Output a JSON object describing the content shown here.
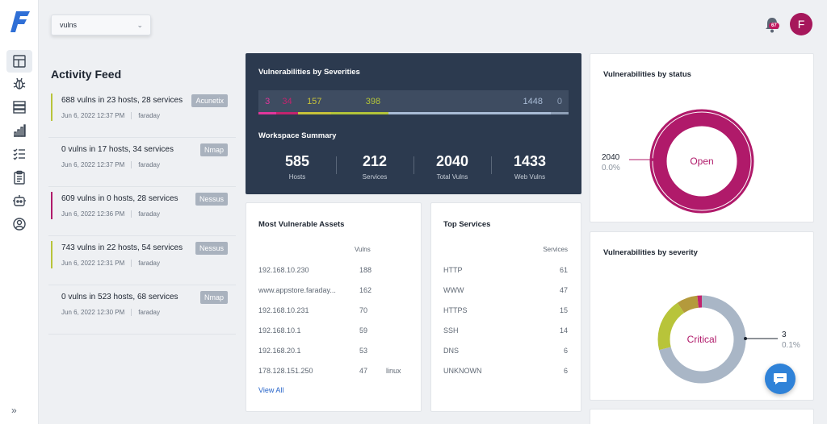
{
  "app": {
    "avatar_initial": "F",
    "notification_count": "67",
    "brand_color": "#2f6fd6",
    "accent": "#a6175b"
  },
  "nav": {
    "items": [
      {
        "name": "dashboard-icon"
      },
      {
        "name": "bug-icon"
      },
      {
        "name": "server-icon"
      },
      {
        "name": "bar-chart-icon"
      },
      {
        "name": "checklist-icon"
      },
      {
        "name": "clipboard-icon"
      },
      {
        "name": "robot-icon"
      },
      {
        "name": "user-circle-icon"
      }
    ],
    "collapse_label": "»"
  },
  "workspace_select": {
    "value": "vulns"
  },
  "feed": {
    "title": "Activity Feed",
    "items": [
      {
        "headline": "688 vulns in 23 hosts, 28 services",
        "date": "Jun 6, 2022 12:37 PM",
        "user": "faraday",
        "tool": "Acunetix",
        "color": "#b8c43a"
      },
      {
        "headline": "0 vulns in 17 hosts, 34 services",
        "date": "Jun 6, 2022 12:37 PM",
        "user": "faraday",
        "tool": "Nmap",
        "color": ""
      },
      {
        "headline": "609 vulns in 0 hosts, 28 services",
        "date": "Jun 6, 2022 12:36 PM",
        "user": "faraday",
        "tool": "Nessus",
        "color": "#b01a6a"
      },
      {
        "headline": "743 vulns in 22 hosts, 54 services",
        "date": "Jun 6, 2022 12:31 PM",
        "user": "faraday",
        "tool": "Nessus",
        "color": "#b8c43a"
      },
      {
        "headline": "0 vulns in 523 hosts, 68 services",
        "date": "Jun 6, 2022 12:30 PM",
        "user": "faraday",
        "tool": "Nmap",
        "color": ""
      }
    ]
  },
  "severities": {
    "title": "Vulnerabilities by Severities",
    "segments": [
      {
        "label": "3",
        "value": 3,
        "color": "#e0379c"
      },
      {
        "label": "34",
        "value": 34,
        "color": "#c2246e"
      },
      {
        "label": "157",
        "value": 157,
        "color": "#c7c23a"
      },
      {
        "label": "398",
        "value": 398,
        "color": "#b3c43a"
      },
      {
        "label": "1448",
        "value": 1448,
        "color": "#a9bcd6"
      },
      {
        "label": "0",
        "value": 0,
        "color": "#8fa0b8"
      }
    ]
  },
  "summary": {
    "title": "Workspace Summary",
    "stats": [
      {
        "value": "585",
        "label": "Hosts"
      },
      {
        "value": "212",
        "label": "Services"
      },
      {
        "value": "2040",
        "label": "Total Vulns"
      },
      {
        "value": "1433",
        "label": "Web Vulns"
      }
    ]
  },
  "status_chart": {
    "title": "Vulnerabilities by status",
    "center_label": "Open",
    "value": "2040",
    "percent": "0.0%",
    "color": "#b01a6a"
  },
  "severity_chart": {
    "title": "Vulnerabilities by severity",
    "center_label": "Critical",
    "value": "3",
    "percent": "0.1%",
    "slices": [
      {
        "value": 1448,
        "color": "#a9b6c6"
      },
      {
        "value": 398,
        "color": "#b8c43a"
      },
      {
        "value": 157,
        "color": "#b49a3c"
      },
      {
        "value": 34,
        "color": "#c2246e"
      },
      {
        "value": 3,
        "color": "#e0379c"
      }
    ]
  },
  "assets": {
    "title": "Most Vulnerable Assets",
    "col_header": "Vulns",
    "rows": [
      {
        "name": "192.168.10.230",
        "vulns": "188",
        "os": ""
      },
      {
        "name": "www.appstore.faraday...",
        "vulns": "162",
        "os": ""
      },
      {
        "name": "192.168.10.231",
        "vulns": "70",
        "os": ""
      },
      {
        "name": "192.168.10.1",
        "vulns": "59",
        "os": ""
      },
      {
        "name": "192.168.20.1",
        "vulns": "53",
        "os": ""
      },
      {
        "name": "178.128.151.250",
        "vulns": "47",
        "os": "linux"
      }
    ],
    "view_all": "View All"
  },
  "services": {
    "title": "Top Services",
    "col_header": "Services",
    "rows": [
      {
        "name": "HTTP",
        "count": "61"
      },
      {
        "name": "WWW",
        "count": "47"
      },
      {
        "name": "HTTPS",
        "count": "15"
      },
      {
        "name": "SSH",
        "count": "14"
      },
      {
        "name": "DNS",
        "count": "6"
      },
      {
        "name": "UNKNOWN",
        "count": "6"
      }
    ]
  }
}
